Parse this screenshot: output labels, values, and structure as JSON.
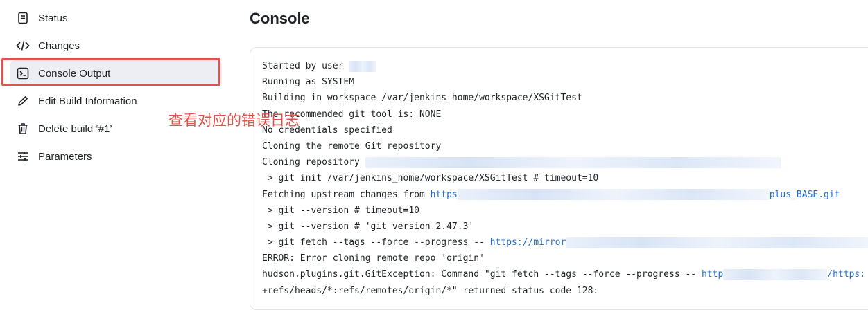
{
  "sidebar": {
    "items": [
      {
        "label": "Status",
        "icon": "document-icon"
      },
      {
        "label": "Changes",
        "icon": "code-icon"
      },
      {
        "label": "Console Output",
        "icon": "terminal-icon",
        "active": true
      },
      {
        "label": "Edit Build Information",
        "icon": "edit-icon"
      },
      {
        "label": "Delete build ‘#1’",
        "icon": "trash-icon"
      },
      {
        "label": "Parameters",
        "icon": "sliders-icon"
      }
    ]
  },
  "annotation": {
    "text": "查看对应的错误日志",
    "color": "#e3524a"
  },
  "main": {
    "title": "Console",
    "lines": {
      "l1": "Started by user",
      "l2": "Running as SYSTEM",
      "l3": "Building in workspace /var/jenkins_home/workspace/XSGitTest",
      "l4": "The recommended git tool is: NONE",
      "l5": "No credentials specified",
      "l6": "Cloning the remote Git repository",
      "l7": "Cloning repository",
      "l8": " > git init /var/jenkins_home/workspace/XSGitTest # timeout=10",
      "l9_prefix": "Fetching upstream changes from ",
      "l9_link_a": "https",
      "l9_link_b": "plus_BASE.git",
      "l10": " > git --version # timeout=10",
      "l11": " > git --version # 'git version 2.47.3'",
      "l12_prefix": " > git fetch --tags --force --progress -- ",
      "l12_link": "https://mirror",
      "l13": "ERROR: Error cloning remote repo 'origin'",
      "l14_prefix": "hudson.plugins.git.GitException: Command \"git fetch --tags --force --progress -- ",
      "l14_link": "http",
      "l14_link_b": "/https:",
      "l15": "+refs/heads/*:refs/remotes/origin/*\" returned status code 128:"
    }
  },
  "colors": {
    "accent_red": "#e3524a",
    "link": "#1e6fd9",
    "active_bg": "#eceef3"
  }
}
